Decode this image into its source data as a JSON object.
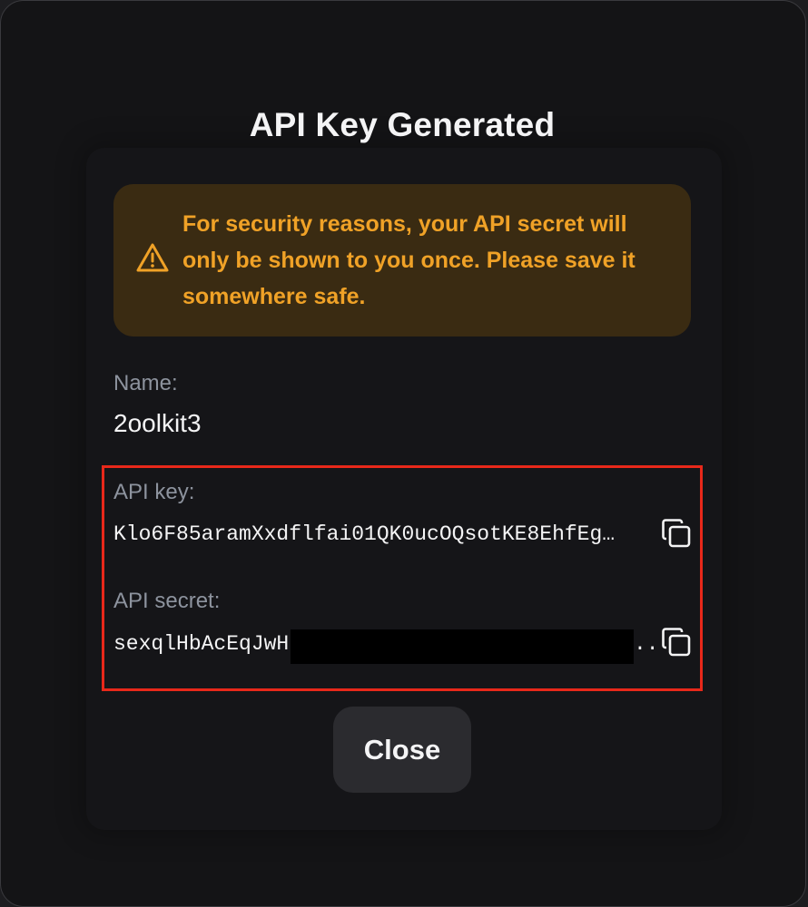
{
  "dialog": {
    "title": "API Key Generated",
    "warning": {
      "icon": "warning-triangle-icon",
      "text": "For security reasons, your API secret will only be shown to you once. Please save it somewhere safe.",
      "color": "#f0a227"
    },
    "name": {
      "label": "Name:",
      "value": "2oolkit3"
    },
    "api_key": {
      "label": "API key:",
      "value": "Klo6F85aramXxdflfai01QK0ucOQsotKE8EhfEg…",
      "copy_icon": "copy-icon"
    },
    "api_secret": {
      "label": "API secret:",
      "value_prefix": "sexqlHbAcEqJwH",
      "value_suffix": "..",
      "copy_icon": "copy-icon"
    },
    "close_label": "Close"
  },
  "highlight_color": "#e8281a"
}
